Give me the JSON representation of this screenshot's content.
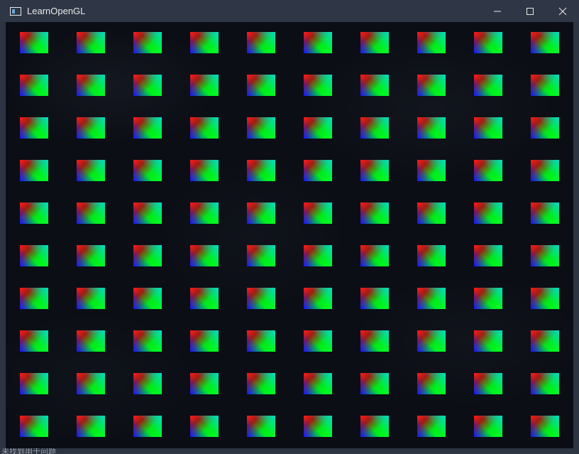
{
  "window": {
    "title": "LearnOpenGL",
    "app_icon": "window-app-icon",
    "controls": [
      {
        "name": "minimize",
        "icon": "minimize-icon"
      },
      {
        "name": "maximize",
        "icon": "maximize-icon"
      },
      {
        "name": "close",
        "icon": "close-icon"
      }
    ]
  },
  "viewport": {
    "background_color": "#0b0e15",
    "quads": {
      "rows": 10,
      "columns": 10,
      "colors": {
        "top_left": "#ff1a1a",
        "bottom_left": "#1a10ff",
        "right": "#00ff22",
        "top_right": "#00dcc8"
      }
    }
  },
  "bottom_bar": {
    "text": "未找到用于问题"
  }
}
